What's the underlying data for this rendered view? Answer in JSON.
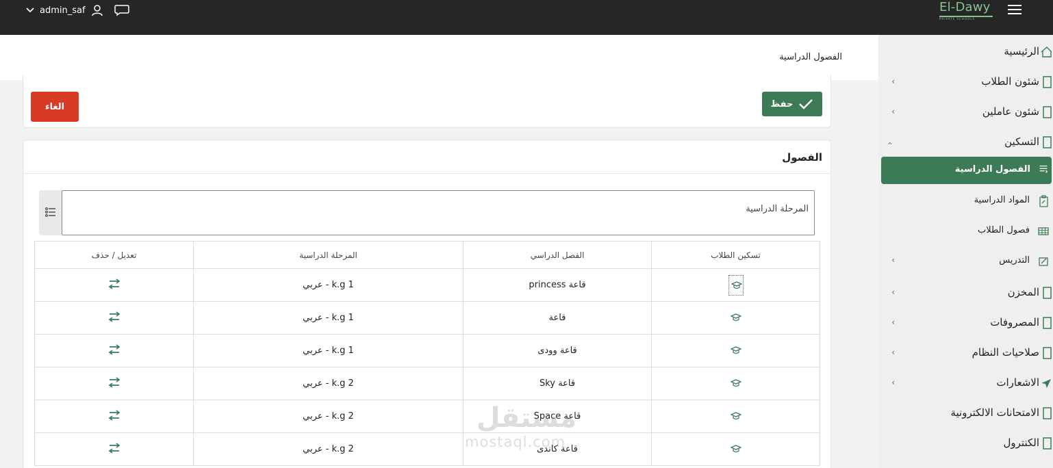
{
  "topbar": {
    "username": "admin_saf",
    "brand_name": "El-Dawy",
    "brand_sub": "PRIVATE SCHOOLS"
  },
  "page": {
    "title": "الفصول الدراسية"
  },
  "actions": {
    "save_label": "حفظ",
    "cancel_label": "الغاء"
  },
  "section": {
    "title": "الفصول",
    "filter_placeholder": "المرحلة الدراسية"
  },
  "table": {
    "headers": [
      "تسكين الطلاب",
      "الفصل الدراسي",
      "المرحلة الدراسية",
      "تعديل / حذف"
    ],
    "rows": [
      {
        "class": "قاعة princess",
        "stage": "k.g 1 - عربي"
      },
      {
        "class": "قاعة",
        "stage": "k.g 1 - عربي"
      },
      {
        "class": "قاعة وودى",
        "stage": "k.g 1 - عربي"
      },
      {
        "class": "قاعة Sky",
        "stage": "k.g 2 - عربي"
      },
      {
        "class": "قاعة Space",
        "stage": "k.g 2 - عربي"
      },
      {
        "class": "قاعة كاندى",
        "stage": "k.g 2 - عربي"
      }
    ]
  },
  "sidebar": {
    "items": [
      {
        "label": "الرئيسية",
        "icon": "home-icon"
      },
      {
        "label": "شئون الطلاب",
        "icon": "folder-icon"
      },
      {
        "label": "شئون عاملين",
        "icon": "folder-icon"
      },
      {
        "label": "التسكين",
        "icon": "folder-icon"
      },
      {
        "label": "الفصول الدراسية",
        "icon": "list-icon"
      },
      {
        "label": "المواد الدراسية",
        "icon": "clipboard-icon"
      },
      {
        "label": "فصول الطلاب",
        "icon": "table-icon"
      },
      {
        "label": "التدريس",
        "icon": "edit-icon"
      },
      {
        "label": "المخزن",
        "icon": "folder-icon"
      },
      {
        "label": "المصروفات",
        "icon": "folder-icon"
      },
      {
        "label": "صلاحيات النظام",
        "icon": "folder-icon"
      },
      {
        "label": "الاشعارات",
        "icon": "send-icon"
      },
      {
        "label": "الامتحانات الالكترونية",
        "icon": "folder-icon"
      },
      {
        "label": "الكنترول",
        "icon": "folder-icon"
      }
    ]
  },
  "watermark": {
    "arabic": "مستقل",
    "latin": "mostaql.com"
  },
  "colors": {
    "primary": "#3c7b55",
    "danger": "#d83a26",
    "topbar": "#262626",
    "brand": "#86c48e"
  }
}
